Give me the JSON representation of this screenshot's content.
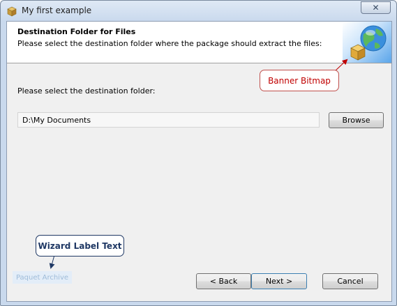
{
  "window": {
    "title": "My first example",
    "close_symbol": "✕",
    "app_icon": "package-icon"
  },
  "banner": {
    "title": "Destination Folder for Files",
    "subtitle": "Please select the destination folder where the package should extract the files:",
    "bitmap": "globe-package-icon"
  },
  "content": {
    "prompt": "Please select the destination folder:",
    "folder_value": "D:\\My Documents",
    "browse_label": "Browse"
  },
  "wizard_label": "Paquet Archive",
  "footer": {
    "back_label": "< Back",
    "next_label": "Next >",
    "cancel_label": "Cancel"
  },
  "annotations": {
    "banner_bitmap": "Banner Bitmap",
    "wizard_label_text": "Wizard Label Text"
  },
  "colors": {
    "banner_callout": "#c00000",
    "wizard_callout": "#1f3864",
    "wizard_label_bg": "#e3edf8"
  }
}
